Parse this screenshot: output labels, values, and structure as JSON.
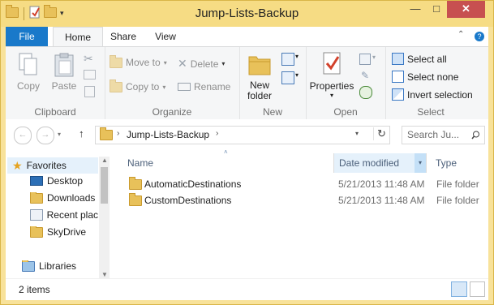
{
  "window": {
    "title": "Jump-Lists-Backup",
    "min_glyph": "—",
    "max_glyph": "□",
    "close_glyph": "✕"
  },
  "tabs": {
    "file": "File",
    "home": "Home",
    "share": "Share",
    "view": "View"
  },
  "ribbon": {
    "clipboard": {
      "label": "Clipboard",
      "copy": "Copy",
      "paste": "Paste"
    },
    "organize": {
      "label": "Organize",
      "move_to": "Move to",
      "copy_to": "Copy to",
      "delete": "Delete",
      "rename": "Rename"
    },
    "new": {
      "label": "New",
      "new_folder": "New\nfolder"
    },
    "open": {
      "label": "Open",
      "properties": "Properties"
    },
    "select": {
      "label": "Select",
      "select_all": "Select all",
      "select_none": "Select none",
      "invert_selection": "Invert selection"
    }
  },
  "address": {
    "segment": "Jump-Lists-Backup",
    "search_placeholder": "Search Ju..."
  },
  "nav_pane": {
    "favorites": "Favorites",
    "items": [
      "Desktop",
      "Downloads",
      "Recent plac",
      "SkyDrive"
    ],
    "libraries": "Libraries"
  },
  "columns": {
    "name": "Name",
    "date_modified": "Date modified",
    "type": "Type"
  },
  "files": [
    {
      "name": "AutomaticDestinations",
      "date": "5/21/2013 11:48 AM",
      "type": "File folder"
    },
    {
      "name": "CustomDestinations",
      "date": "5/21/2013 11:48 AM",
      "type": "File folder"
    }
  ],
  "status": {
    "count": "2 items"
  },
  "colors": {
    "file_tab": "#1979ca",
    "title_bar": "#f6dc84",
    "close_button": "#c75050"
  }
}
